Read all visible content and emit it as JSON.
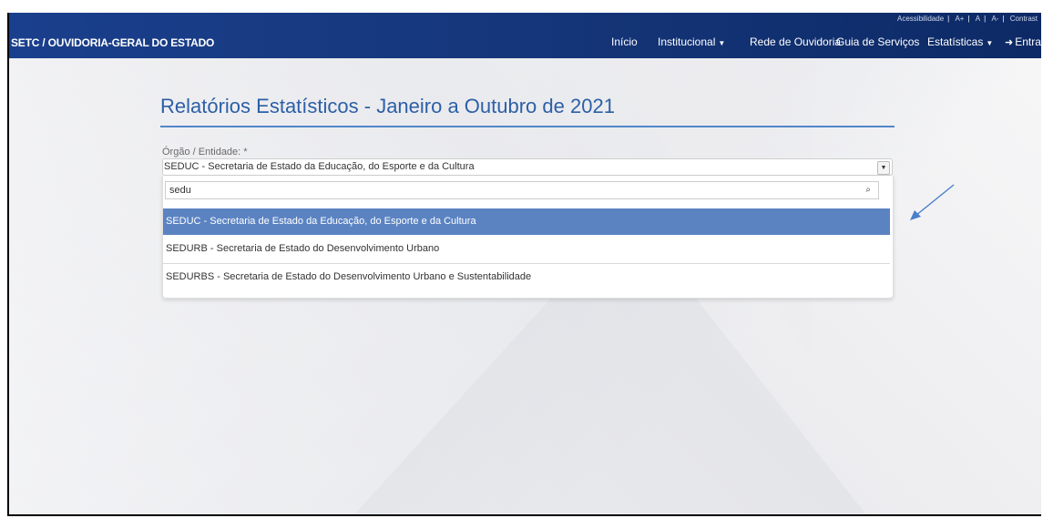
{
  "navbar": {
    "brand": "SETC / OUVIDORIA-GERAL DO ESTADO",
    "topbar": {
      "accessibility": "Acessibilidade",
      "font_increase": "A+",
      "font_normal": "A",
      "font_decrease": "A-",
      "contrast": "Contrast"
    },
    "menu": {
      "inicio": "Início",
      "institucional": "Institucional",
      "rede": "Rede de Ouvidoria",
      "guia": "Guia de Serviços",
      "estatisticas": "Estatísticas",
      "entrar": "Entrar"
    },
    "color": "#15367a"
  },
  "main": {
    "title": "Relatórios Estatísticos - Janeiro a Outubro de 2021",
    "field_label": "Órgão / Entidade:  *",
    "selected_value": "SEDUC - Secretaria de Estado da Educação, do Esporte e da Cultura",
    "search_value": "sedu",
    "options": [
      "SEDUC - Secretaria de Estado da Educação, do Esporte e da Cultura",
      "SEDURB - Secretaria de Estado do Desenvolvimento Urbano",
      "SEDURBS - Secretaria de Estado do Desenvolvimento Urbano e Sustentabilidade"
    ],
    "highlight_color": "#5b83c2"
  }
}
